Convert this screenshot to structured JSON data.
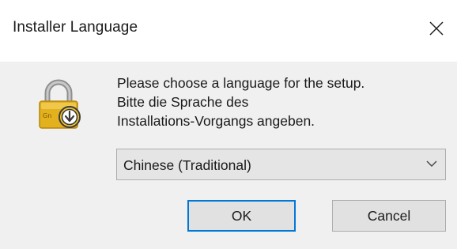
{
  "window": {
    "title": "Installer Language"
  },
  "dialog": {
    "message_lines": [
      "Please choose a language for the setup.",
      "Bitte die Sprache des",
      "Installations-Vorgangs angeben."
    ],
    "icon": "lock-download-icon",
    "language_select": {
      "selected": "Chinese (Traditional)"
    },
    "buttons": {
      "ok_label": "OK",
      "cancel_label": "Cancel"
    }
  },
  "colors": {
    "dialog_background": "#f0f0f0",
    "default_button_border": "#0078d7",
    "lock_body": "#e8b82a",
    "lock_shackle": "#9a9a9a"
  }
}
